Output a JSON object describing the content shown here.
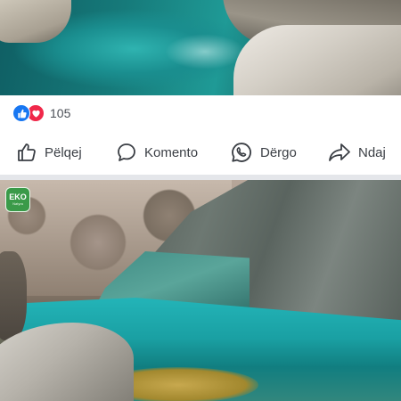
{
  "post": {
    "reactions": {
      "count": "105",
      "types": [
        "like-icon",
        "love-icon"
      ],
      "colors": {
        "like": "#1877f2",
        "love": "#f0284a"
      }
    },
    "actions": {
      "like_label": "Pëlqej",
      "comment_label": "Komento",
      "send_label": "Dërgo",
      "share_label": "Ndaj"
    }
  },
  "next_post": {
    "watermark": {
      "text": "EKO",
      "sub": "Natyra"
    }
  }
}
